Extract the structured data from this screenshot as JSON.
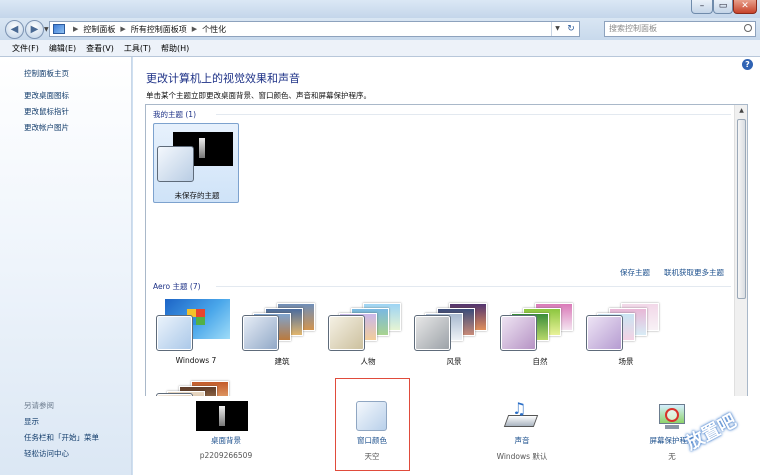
{
  "window": {
    "minimize_label": "–",
    "maximize_label": "▭",
    "close_label": "✕"
  },
  "nav": {
    "back_label": "◀",
    "forward_label": "▶",
    "history_dropdown": "▼"
  },
  "address": {
    "crumbs": [
      "控制面板",
      "所有控制面板项",
      "个性化"
    ],
    "separator": "▶",
    "dropdown": "▼",
    "refresh_label": "↻"
  },
  "search": {
    "placeholder": "搜索控制面板"
  },
  "menu": [
    "文件(F)",
    "编辑(E)",
    "查看(V)",
    "工具(T)",
    "帮助(H)"
  ],
  "sidebar": {
    "links": [
      "控制面板主页",
      "更改桌面图标",
      "更改鼠标指针",
      "更改帐户图片"
    ],
    "see_also_title": "另请参阅",
    "see_also": [
      "显示",
      "任务栏和「开始」菜单",
      "轻松访问中心"
    ]
  },
  "main": {
    "help_label": "?",
    "heading": "更改计算机上的视觉效果和声音",
    "subheading": "单击某个主题立即更改桌面背景、窗口颜色、声音和屏幕保护程序。",
    "my_themes_title": "我的主题 (1)",
    "unsaved_theme_label": "未保存的主题",
    "save_theme_link": "保存主题",
    "online_themes_link": "联机获取更多主题",
    "aero_title": "Aero 主题 (7)",
    "aero_themes": [
      "Windows 7",
      "建筑",
      "人物",
      "风景",
      "自然",
      "场景",
      "中国"
    ],
    "scroll_up": "▲",
    "scroll_down": "▼"
  },
  "bottom": [
    {
      "title": "桌面背景",
      "value": "p2209266509",
      "icon": "desktop-background-icon"
    },
    {
      "title": "窗口颜色",
      "value": "天空",
      "icon": "window-color-icon"
    },
    {
      "title": "声音",
      "value": "Windows 默认",
      "icon": "sound-icon"
    },
    {
      "title": "屏幕保护程序",
      "value": "无",
      "icon": "screensaver-icon"
    }
  ],
  "watermark": "放置吧"
}
